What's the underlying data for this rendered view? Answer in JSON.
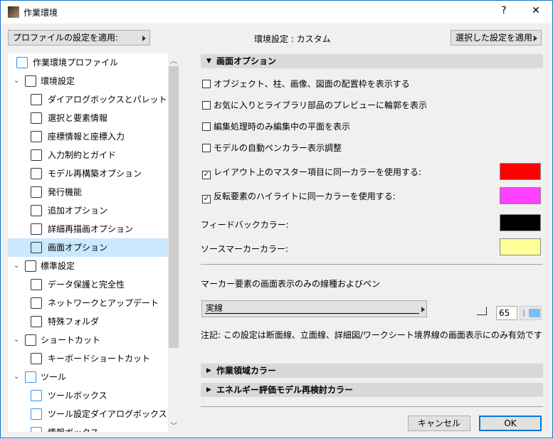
{
  "window": {
    "title": "作業環境",
    "help": "?",
    "close": "✕"
  },
  "toolbar": {
    "apply_profile": "プロファイルの設定を適用:",
    "env_setting": "環境設定 : カスタム",
    "apply_selected": "選択した設定を適用:"
  },
  "tree": [
    {
      "label": "作業環境プロファイル",
      "level": 0,
      "icon": "profile-monitor-icon"
    },
    {
      "label": "環境設定",
      "level": 1,
      "icon": "user-settings-icon",
      "expanded": true
    },
    {
      "label": "ダイアログボックスとパレット",
      "level": 2,
      "icon": "dialog-palette-icon"
    },
    {
      "label": "選択と要素情報",
      "level": 2,
      "icon": "selection-info-icon"
    },
    {
      "label": "座標情報と座標入力",
      "level": 2,
      "icon": "xyz-icon"
    },
    {
      "label": "入力制約とガイド",
      "level": 2,
      "icon": "mouse-cursor-icon"
    },
    {
      "label": "モデル再構築オプション",
      "level": 2,
      "icon": "rebuild-icon"
    },
    {
      "label": "発行機能",
      "level": 2,
      "icon": "publish-icon"
    },
    {
      "label": "追加オプション",
      "level": 2,
      "icon": "sliders-icon"
    },
    {
      "label": "詳細再描画オプション",
      "level": 2,
      "icon": "redraw-icon"
    },
    {
      "label": "画面オプション",
      "level": 2,
      "icon": "monitor-icon",
      "selected": true
    },
    {
      "label": "標準設定",
      "level": 1,
      "icon": "standard-settings-icon",
      "expanded": true
    },
    {
      "label": "データ保護と完全性",
      "level": 2,
      "icon": "shield-icon"
    },
    {
      "label": "ネットワークとアップデート",
      "level": 2,
      "icon": "globe-icon"
    },
    {
      "label": "特殊フォルダ",
      "level": 2,
      "icon": "folder-icon"
    },
    {
      "label": "ショートカット",
      "level": 1,
      "icon": "shortcut-icon",
      "expanded": true
    },
    {
      "label": "キーボードショートカット",
      "level": 2,
      "icon": "shortcut-arrow-icon"
    },
    {
      "label": "ツール",
      "level": 1,
      "icon": "tools-icon",
      "expanded": true
    },
    {
      "label": "ツールボックス",
      "level": 2,
      "icon": "toolbox-icon"
    },
    {
      "label": "ツール設定ダイアログボックス",
      "level": 2,
      "icon": "tool-settings-icon"
    },
    {
      "label": "情報ボックス",
      "level": 2,
      "icon": "info-box-icon"
    }
  ],
  "main": {
    "section_title": "画面オプション",
    "checkboxes": [
      {
        "label": "オブジェクト、柱、画像、図面の配置枠を表示する",
        "checked": false
      },
      {
        "label": "お気に入りとライブラリ部品のプレビューに輪郭を表示",
        "checked": false
      },
      {
        "label": "編集処理時のみ編集中の平面を表示",
        "checked": false
      },
      {
        "label": "モデルの自動ペンカラー表示調整",
        "checked": false
      },
      {
        "label": "レイアウト上のマスター項目に同一カラーを使用する:",
        "checked": true,
        "color": "#ff0000"
      },
      {
        "label": "反転要素のハイライトに同一カラーを使用する:",
        "checked": true,
        "color": "#ff40ff"
      }
    ],
    "feedback_color_label": "フィードバックカラー:",
    "feedback_color": "#000000",
    "source_marker_label": "ソースマーカーカラー:",
    "source_marker_color": "#ffff99",
    "marker_line_label": "マーカー要素の画面表示のみの線種およびペン",
    "line_type": "実線",
    "pen_number": "65",
    "pen_color": "#7cbcf7",
    "note": "注記: この設定は断面線、立面線、詳細図/ワークシート境界線の画面表示にのみ有効です",
    "collapsed_sections": [
      "作業領域カラー",
      "エネルギー評価モデル再検討カラー"
    ]
  },
  "buttons": {
    "cancel": "キャンセル",
    "ok": "OK"
  }
}
